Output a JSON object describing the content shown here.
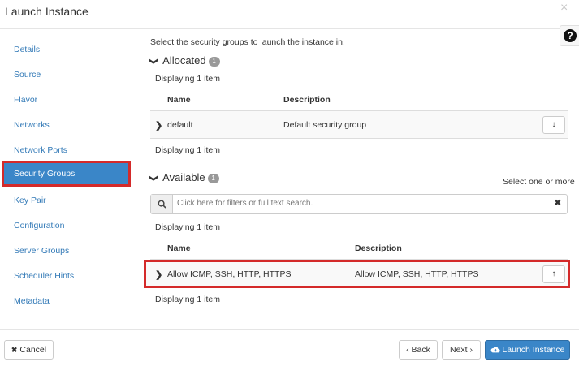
{
  "header": {
    "title": "Launch Instance",
    "close_glyph": "×",
    "help_glyph": "?"
  },
  "nav": {
    "items": [
      {
        "label": "Details"
      },
      {
        "label": "Source"
      },
      {
        "label": "Flavor"
      },
      {
        "label": "Networks"
      },
      {
        "label": "Network Ports"
      },
      {
        "label": "Security Groups",
        "active": true
      },
      {
        "label": "Key Pair"
      },
      {
        "label": "Configuration"
      },
      {
        "label": "Server Groups"
      },
      {
        "label": "Scheduler Hints"
      },
      {
        "label": "Metadata"
      }
    ]
  },
  "intro": "Select the security groups to launch the instance in.",
  "allocated": {
    "title": "Allocated",
    "count": "1",
    "displaying_top": "Displaying 1 item",
    "col_name": "Name",
    "col_desc": "Description",
    "rows": [
      {
        "name": "default",
        "description": "Default security group"
      }
    ],
    "displaying_bottom": "Displaying 1 item"
  },
  "available": {
    "title": "Available",
    "count": "1",
    "select_hint": "Select one or more",
    "filter_placeholder": "Click here for filters or full text search.",
    "displaying_top": "Displaying 1 item",
    "col_name": "Name",
    "col_desc": "Description",
    "rows": [
      {
        "name": "Allow ICMP, SSH, HTTP, HTTPS",
        "description": "Allow ICMP, SSH, HTTP, HTTPS"
      }
    ],
    "displaying_bottom": "Displaying 1 item"
  },
  "footer": {
    "cancel_label": "Cancel",
    "back_label": "‹ Back",
    "next_label": "Next ›",
    "launch_label": "Launch Instance"
  },
  "colors": {
    "accent": "#3a86c8",
    "highlight_border": "#d42a2a"
  }
}
